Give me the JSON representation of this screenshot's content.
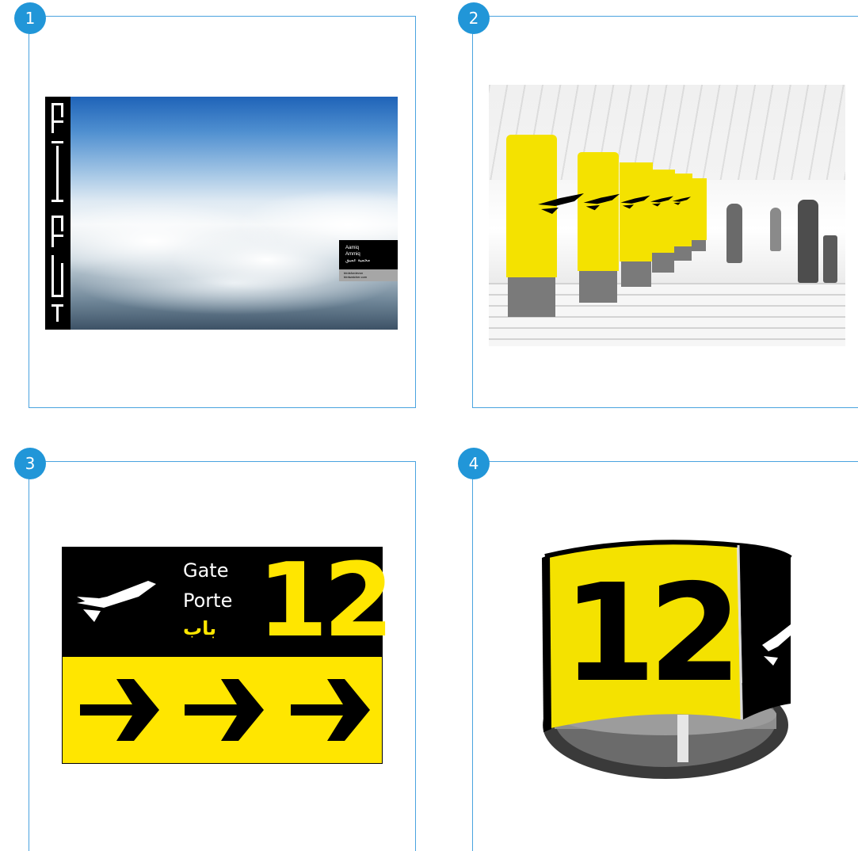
{
  "panels": [
    {
      "number": "1"
    },
    {
      "number": "2"
    },
    {
      "number": "3"
    },
    {
      "number": "4"
    }
  ],
  "panel1": {
    "label_lines": [
      "Aamiq",
      "Ammiq",
      "محمية عميق"
    ],
    "label_sub": [
      "birdsfordevon",
      "birdwatcher.com"
    ]
  },
  "panel3": {
    "gate_en": "Gate",
    "gate_fr": "Porte",
    "gate_ar": "باب",
    "gate_number": "12"
  },
  "panel4": {
    "gate_number": "12"
  },
  "colors": {
    "frame": "#4aa3df",
    "badge": "#2196d8",
    "sign_yellow": "#ffe600",
    "sign_black": "#000000"
  },
  "icons": [
    "plane-icon",
    "arrow-right-icon"
  ]
}
